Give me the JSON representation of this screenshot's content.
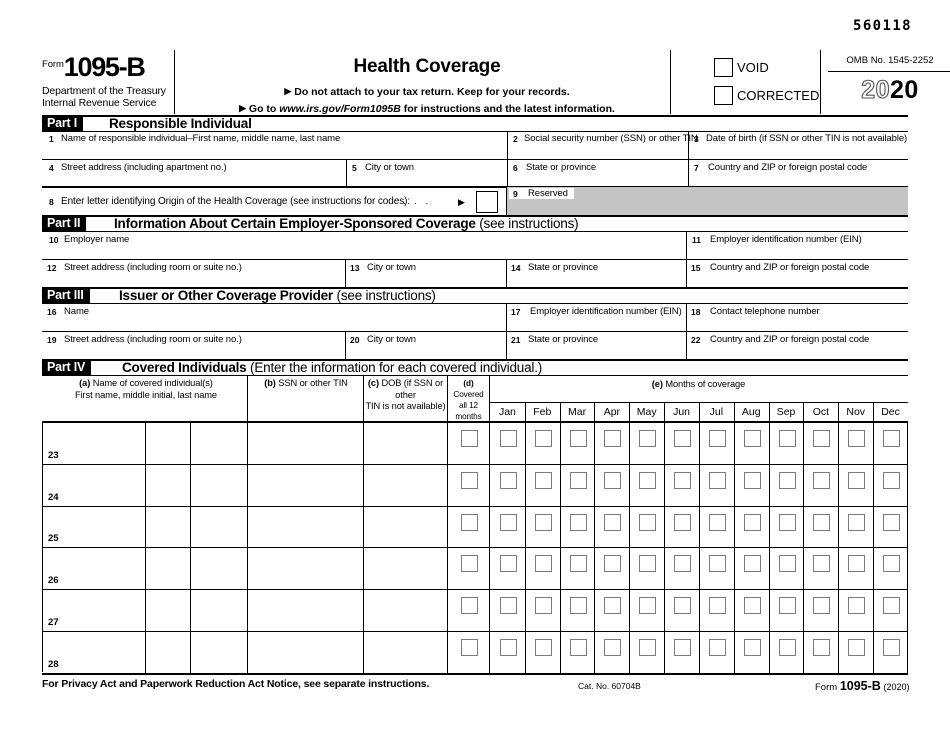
{
  "scan_id": "560118",
  "header": {
    "form_word": "Form",
    "form_number": "1095-B",
    "dept_line1": "Department of the Treasury",
    "dept_line2": "Internal Revenue Service",
    "title": "Health Coverage",
    "instruction_1": "Do not attach to your tax return. Keep for your records.",
    "instruction_2_prefix": "Go to",
    "instruction_2_url": "www.irs.gov/Form1095B",
    "instruction_2_suffix": "for instructions and the latest information.",
    "void_label": "VOID",
    "corrected_label": "CORRECTED",
    "omb": "OMB No. 1545-2252",
    "year_light": "20",
    "year_bold": "20"
  },
  "part1": {
    "tag": "Part I",
    "title": "Responsible Individual",
    "fields": [
      {
        "num": "1",
        "label": "Name of responsible individual–First name, middle name, last name"
      },
      {
        "num": "2",
        "label": "Social security number (SSN) or other TIN"
      },
      {
        "num": "3",
        "label": "Date of birth (if SSN or other TIN is not available)"
      },
      {
        "num": "4",
        "label": "Street address (including apartment no.)"
      },
      {
        "num": "5",
        "label": "City or town"
      },
      {
        "num": "6",
        "label": "State or province"
      },
      {
        "num": "7",
        "label": "Country and ZIP or foreign postal code"
      },
      {
        "num": "8",
        "label": "Enter letter identifying Origin of the Health Coverage (see instructions for codes):"
      },
      {
        "num": "9",
        "label": "Reserved"
      }
    ],
    "line8_dots": ".   .   .",
    "line8_arrow": "▶"
  },
  "part2": {
    "tag": "Part II",
    "title": "Information About Certain Employer-Sponsored Coverage",
    "title_light": "(see instructions)",
    "fields": [
      {
        "num": "10",
        "label": "Employer name"
      },
      {
        "num": "11",
        "label": "Employer identification number (EIN)"
      },
      {
        "num": "12",
        "label": "Street address (including room or suite no.)"
      },
      {
        "num": "13",
        "label": "City or town"
      },
      {
        "num": "14",
        "label": "State or province"
      },
      {
        "num": "15",
        "label": "Country and ZIP or foreign postal code"
      }
    ]
  },
  "part3": {
    "tag": "Part III",
    "title": "Issuer or Other Coverage Provider",
    "title_light": "(see instructions)",
    "fields": [
      {
        "num": "16",
        "label": "Name"
      },
      {
        "num": "17",
        "label": "Employer identification number (EIN)"
      },
      {
        "num": "18",
        "label": "Contact telephone number"
      },
      {
        "num": "19",
        "label": "Street address (including room or suite no.)"
      },
      {
        "num": "20",
        "label": "City or town"
      },
      {
        "num": "21",
        "label": "State or province"
      },
      {
        "num": "22",
        "label": "Country and ZIP or foreign postal code"
      }
    ]
  },
  "part4": {
    "tag": "Part IV",
    "title": "Covered Individuals",
    "title_light": "(Enter the information for each covered individual.)",
    "col_a_bold": "(a)",
    "col_a_line1": "Name of covered individual(s)",
    "col_a_line2": "First name, middle initial, last name",
    "col_b_bold": "(b)",
    "col_b_text": "SSN or other TIN",
    "col_c_bold": "(c)",
    "col_c_line1": "DOB (if SSN or other",
    "col_c_line2": "TIN is not available)",
    "col_d_bold": "(d)",
    "col_d_line1": "Covered",
    "col_d_line2": "all 12 months",
    "col_e_bold": "(e)",
    "col_e_text": "Months of coverage",
    "months": [
      "Jan",
      "Feb",
      "Mar",
      "Apr",
      "May",
      "Jun",
      "Jul",
      "Aug",
      "Sep",
      "Oct",
      "Nov",
      "Dec"
    ],
    "row_numbers": [
      "23",
      "24",
      "25",
      "26",
      "27",
      "28"
    ]
  },
  "footer": {
    "privacy": "For Privacy Act and Paperwork Reduction Act Notice, see separate instructions.",
    "cat_no": "Cat. No. 60704B",
    "form_word": "Form",
    "form_number": "1095-B",
    "form_year": "(2020)"
  },
  "colors": {
    "ink": "#000000",
    "reserved_shade": "#c4c4c4",
    "checkbox_border": "#7a7a7a"
  }
}
